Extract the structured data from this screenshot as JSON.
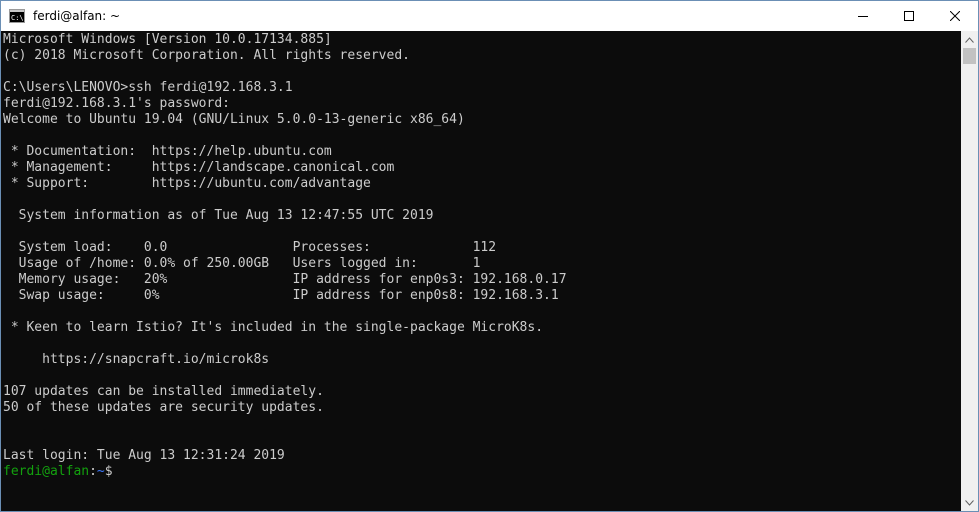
{
  "window": {
    "title": "ferdi@alfan: ~",
    "app_icon": "cmd-icon",
    "controls": [
      "minimize-icon",
      "maximize-icon",
      "close-icon"
    ]
  },
  "terminal": {
    "lines": [
      "Microsoft Windows [Version 10.0.17134.885]",
      "(c) 2018 Microsoft Corporation. All rights reserved.",
      "",
      "C:\\Users\\LENOVO>ssh ferdi@192.168.3.1",
      "ferdi@192.168.3.1's password:",
      "Welcome to Ubuntu 19.04 (GNU/Linux 5.0.0-13-generic x86_64)",
      "",
      " * Documentation:  https://help.ubuntu.com",
      " * Management:     https://landscape.canonical.com",
      " * Support:        https://ubuntu.com/advantage",
      "",
      "  System information as of Tue Aug 13 12:47:55 UTC 2019",
      "",
      "  System load:    0.0                Processes:             112",
      "  Usage of /home: 0.0% of 250.00GB   Users logged in:       1",
      "  Memory usage:   20%                IP address for enp0s3: 192.168.0.17",
      "  Swap usage:     0%                 IP address for enp0s8: 192.168.3.1",
      "",
      " * Keen to learn Istio? It's included in the single-package MicroK8s.",
      "",
      "     https://snapcraft.io/microk8s",
      "",
      "107 updates can be installed immediately.",
      "50 of these updates are security updates.",
      "",
      "",
      "Last login: Tue Aug 13 12:31:24 2019"
    ],
    "prompt": {
      "user_host": "ferdi@alfan",
      "separator": ":",
      "path": "~",
      "symbol": "$"
    },
    "colors": {
      "background": "#0c0c0c",
      "text": "#cccccc",
      "prompt_user": "#13a10e",
      "prompt_path": "#3b78ff"
    }
  }
}
